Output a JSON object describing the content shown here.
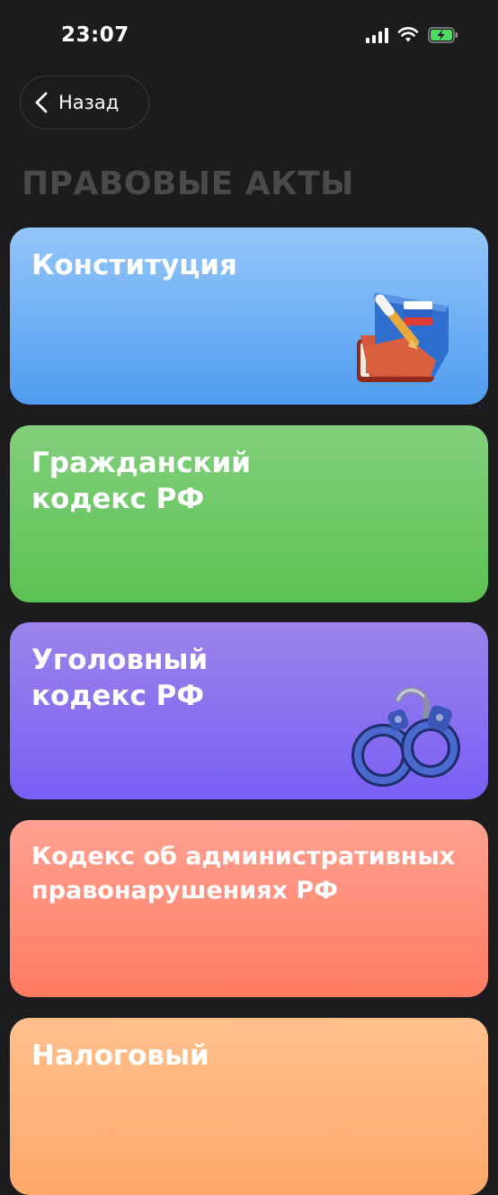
{
  "status_bar": {
    "time": "23:07"
  },
  "nav": {
    "back_label": "Назад"
  },
  "page": {
    "title": "ПРАВОВЫЕ АКТЫ"
  },
  "cards": [
    {
      "title": "Конституция",
      "icon": "book-with-pen-icon"
    },
    {
      "title": "Гражданский\nкодекс РФ"
    },
    {
      "title": "Уголовный\nкодекс РФ",
      "icon": "handcuffs-icon"
    },
    {
      "title": "Кодекс об административных\nправонарушениях РФ"
    },
    {
      "title": "Налоговый"
    }
  ],
  "colors": {
    "background": "#1c1c1e",
    "constitution": "#6aaef4",
    "civil": "#6fc867",
    "criminal": "#8a72ef",
    "administrative": "#ff8e7a",
    "tax": "#ffb47b"
  }
}
